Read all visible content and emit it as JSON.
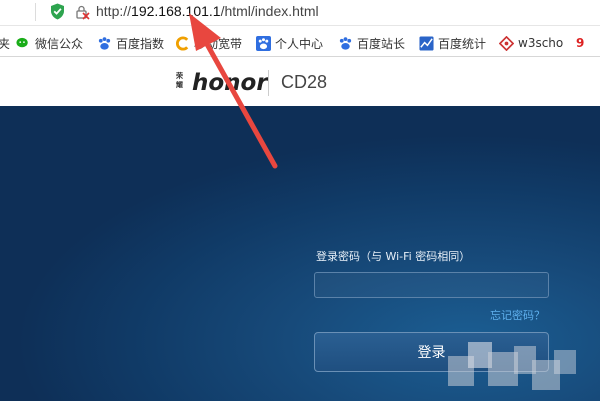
{
  "browser": {
    "url_prefix": "http://",
    "url_host": "192.168.101.1",
    "url_path": "/html/index.html",
    "icons": [
      "shield-check-icon",
      "insecure-lock-icon"
    ]
  },
  "bookmarks": [
    {
      "label": "夹",
      "icon": "none"
    },
    {
      "label": "微信公众",
      "icon": "wechat-icon",
      "color": "#1aad19"
    },
    {
      "label": "百度指数",
      "icon": "baidu-paw-icon",
      "color": "#2f6ee0"
    },
    {
      "label": "移动宽带",
      "icon": "mobile-c-icon",
      "color": "#f0a000"
    },
    {
      "label": "个人中心",
      "icon": "baidu-paw-icon",
      "color": "#2f6ee0"
    },
    {
      "label": "百度站长",
      "icon": "baidu-paw-icon",
      "color": "#2f6ee0"
    },
    {
      "label": "百度统计",
      "icon": "chart-icon",
      "color": "#2a64c8"
    },
    {
      "label": "w3scho",
      "icon": "w3-icon",
      "color": "#c33"
    },
    {
      "label": "9",
      "icon": "note-icon",
      "color": "#d22"
    }
  ],
  "header": {
    "brand_cn": "荣耀",
    "brand_en": "honor",
    "model": "CD28"
  },
  "login": {
    "password_label": "登录密码（与 Wi-Fi 密码相同）",
    "password_value": "",
    "forgot_link": "忘记密码？",
    "login_button": "登录"
  },
  "colors": {
    "panel_bg": "#174a7a",
    "link": "#5fb0ee",
    "annotation": "#e8473f"
  }
}
